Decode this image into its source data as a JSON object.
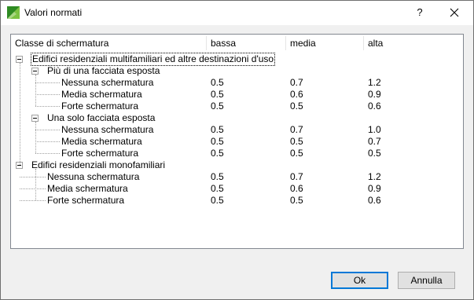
{
  "window": {
    "title": "Valori normati",
    "help_label": "?"
  },
  "columns": [
    "Classe di schermatura",
    "bassa",
    "media",
    "alta"
  ],
  "rows": [
    {
      "label": "Edifici residenziali multifamiliari ed altre destinazioni d'uso",
      "level": 0,
      "expanded": true,
      "focused": true,
      "values": [
        "",
        "",
        ""
      ]
    },
    {
      "label": "Più di una facciata esposta",
      "level": 1,
      "expanded": true,
      "values": [
        "",
        "",
        ""
      ]
    },
    {
      "label": "Nessuna schermatura",
      "level": 2,
      "values": [
        "0.5",
        "0.7",
        "1.2"
      ]
    },
    {
      "label": "Media schermatura",
      "level": 2,
      "values": [
        "0.5",
        "0.6",
        "0.9"
      ]
    },
    {
      "label": "Forte schermatura",
      "level": 2,
      "values": [
        "0.5",
        "0.5",
        "0.6"
      ]
    },
    {
      "label": "Una solo facciata esposta",
      "level": 1,
      "expanded": true,
      "values": [
        "",
        "",
        ""
      ]
    },
    {
      "label": "Nessuna schermatura",
      "level": 2,
      "values": [
        "0.5",
        "0.7",
        "1.0"
      ]
    },
    {
      "label": "Media schermatura",
      "level": 2,
      "values": [
        "0.5",
        "0.5",
        "0.7"
      ]
    },
    {
      "label": "Forte schermatura",
      "level": 2,
      "values": [
        "0.5",
        "0.5",
        "0.5"
      ]
    },
    {
      "label": "Edifici residenziali monofamiliari",
      "level": 0,
      "expanded": true,
      "values": [
        "",
        "",
        ""
      ]
    },
    {
      "label": "Nessuna schermatura",
      "level": 1,
      "values": [
        "0.5",
        "0.7",
        "1.2"
      ]
    },
    {
      "label": "Media schermatura",
      "level": 1,
      "values": [
        "0.5",
        "0.6",
        "0.9"
      ]
    },
    {
      "label": "Forte schermatura",
      "level": 1,
      "values": [
        "0.5",
        "0.5",
        "0.6"
      ]
    }
  ],
  "buttons": {
    "ok": "Ok",
    "cancel": "Annulla"
  },
  "colors": {
    "accent": "#0078d7",
    "border": "#828790",
    "icon_green": "#3a9a2a"
  }
}
